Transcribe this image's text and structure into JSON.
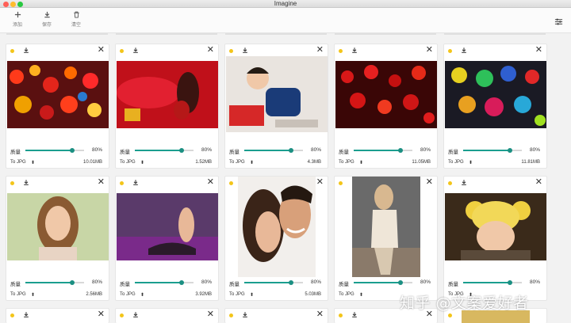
{
  "window": {
    "title": "Imagine"
  },
  "toolbar": {
    "add_label": "添加",
    "save_label": "保存",
    "clear_label": "清空"
  },
  "card_labels": {
    "quality": "质量",
    "format_arrow": "⬍"
  },
  "colors": {
    "accent": "#1b9e8f",
    "status_dot": "#f3c51a"
  },
  "cards": [
    {
      "quality": 80,
      "quality_text": "80%",
      "format": "To JPG",
      "size": "10.01MB"
    },
    {
      "quality": 80,
      "quality_text": "80%",
      "format": "To JPG",
      "size": "1.52MB"
    },
    {
      "quality": 80,
      "quality_text": "80%",
      "format": "To JPG",
      "size": "4.3MB"
    },
    {
      "quality": 80,
      "quality_text": "80%",
      "format": "To JPG",
      "size": "11.05MB"
    },
    {
      "quality": 80,
      "quality_text": "80%",
      "format": "To JPG",
      "size": "11.81MB"
    },
    {
      "quality": 80,
      "quality_text": "80%",
      "format": "To JPG",
      "size": "2.56MB"
    },
    {
      "quality": 80,
      "quality_text": "80%",
      "format": "To JPG",
      "size": "3.92MB"
    },
    {
      "quality": 80,
      "quality_text": "80%",
      "format": "To JPG",
      "size": "5.03MB"
    },
    {
      "quality": 80,
      "quality_text": "80%",
      "format": "To JPG",
      "size": ""
    },
    {
      "quality": 80,
      "quality_text": "80%",
      "format": "To JPG",
      "size": ""
    }
  ],
  "watermark": "知乎 @文案爱好者"
}
